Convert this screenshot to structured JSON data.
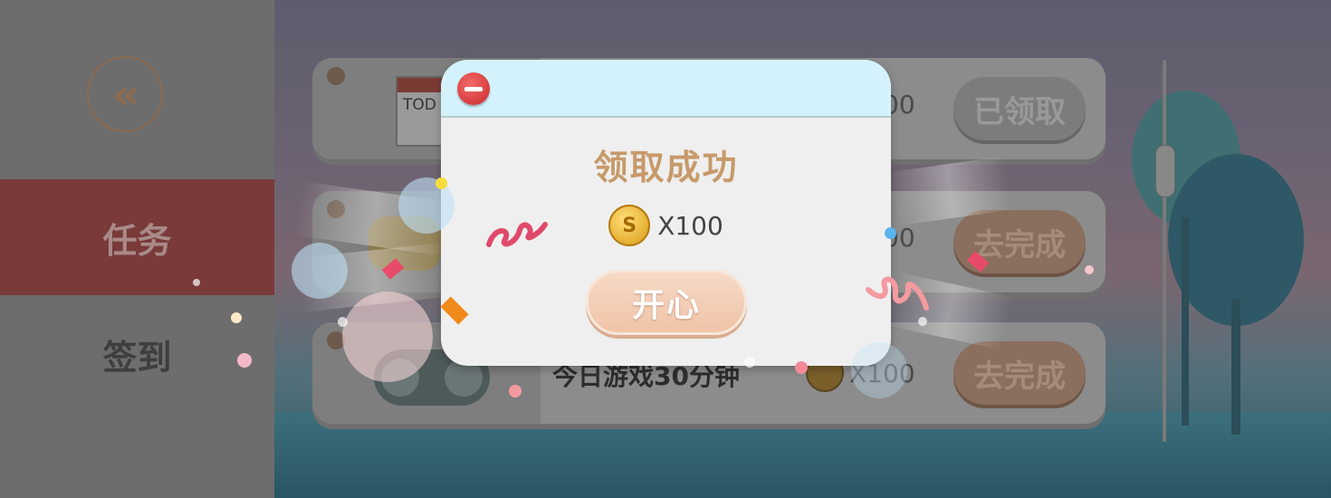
{
  "sidebar": {
    "tabs": [
      {
        "label": "任务",
        "active": true
      },
      {
        "label": "签到",
        "active": false
      }
    ]
  },
  "tasks": [
    {
      "icon": "calendar-icon",
      "icon_text": "TOD",
      "label": "",
      "reward": "00",
      "action": "已领取",
      "state": "claimed"
    },
    {
      "icon": "trophy-icon",
      "label": "",
      "reward": "00",
      "action": "去完成",
      "state": "todo"
    },
    {
      "icon": "gamepad-icon",
      "label": "今日游戏30分钟",
      "reward": "X100",
      "action": "去完成",
      "state": "todo"
    }
  ],
  "modal": {
    "title": "领取成功",
    "reward_amount": "X100",
    "coin_symbol": "S",
    "confirm_label": "开心"
  },
  "colors": {
    "modal_header": "#d4f2fc",
    "title": "#c79a6a",
    "confirm": "#f0c4a8",
    "sidebar_active": "#7a3a3a"
  }
}
